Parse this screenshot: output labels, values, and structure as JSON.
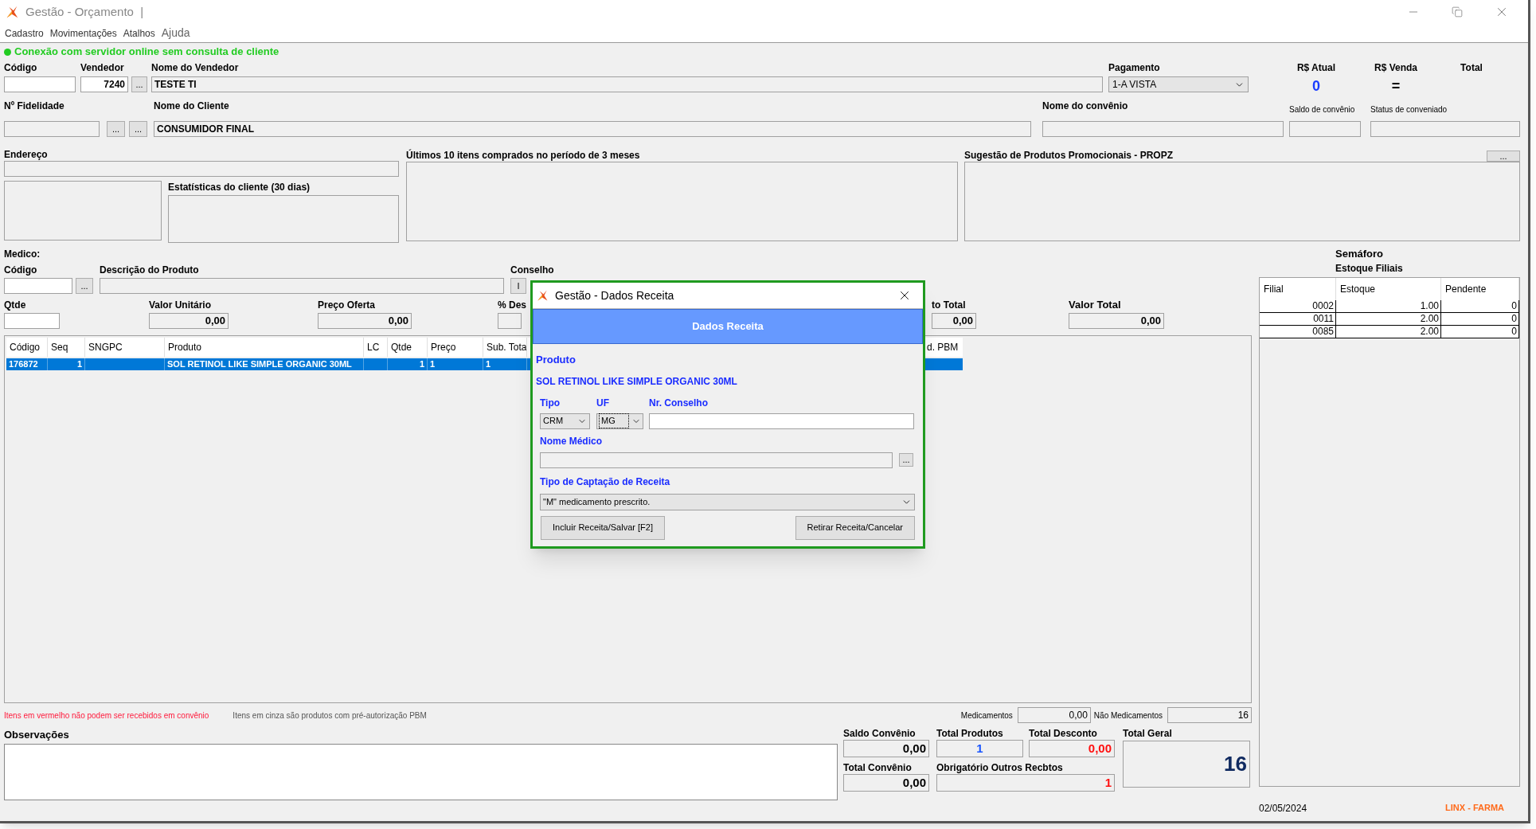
{
  "window": {
    "title": "Gestão - Orçamento  |"
  },
  "menu": [
    {
      "label": "Cadastro",
      "kind": "small"
    },
    {
      "label": "Movimentações",
      "kind": "small"
    },
    {
      "label": "Atalhos",
      "kind": "small"
    },
    {
      "label": "Ajuda",
      "kind": "large"
    }
  ],
  "connection": {
    "online": true,
    "text": "Conexão com servidor online sem consulta de cliente"
  },
  "sale": {
    "codigo_label": "Código",
    "vendedor_label": "Vendedor",
    "vendedor": "7240",
    "vendedor_button": "...",
    "nome_vendedor_label": "Nome do Vendedor",
    "nome_vendedor": "TESTE TI",
    "pagamento_label": "Pagamento",
    "pagamento": "1-A VISTA",
    "rs_atual_label": "R$ Atual",
    "rs_atual": "0",
    "rs_venda_label": "R$ Venda",
    "rs_venda": "=",
    "total_label": "Total"
  },
  "client": {
    "fidelidade_label": "Nº Fidelidade",
    "buttons": [
      "...",
      "..."
    ],
    "nome_cliente_label": "Nome do Cliente",
    "nome_cliente": "CONSUMIDOR FINAL",
    "convenio_label": "Nome do convênio",
    "saldo_label": "Saldo de convênio",
    "status_label": "Status de conveniado"
  },
  "panels": {
    "endereco_label": "Endereço",
    "estatisticas_label": "Estatísticas do cliente  (30 dias)",
    "ultimos_label": "Últimos 10 itens comprados no período de 3 meses",
    "sugestao_label": "Sugestão de Produtos Promocionais - PROPZ",
    "sugestao_button": "..."
  },
  "product_entry": {
    "medico_label": "Medico:",
    "codigo_label": "Código",
    "codigo_button": "...",
    "descricao_label": "Descrição do Produto",
    "conselho_label": "Conselho",
    "conselho_button": "I",
    "qtde_label": "Qtde",
    "valor_unitario_label": "Valor Unitário",
    "valor_unitario": "0,00",
    "preco_oferta_label": "Preço Oferta",
    "preco_oferta": "0,00",
    "desconto_label": "% Des",
    "desconto_total_label": "to Total",
    "desconto_total": "0,00",
    "valor_total_label": "Valor Total",
    "valor_total": "0,00"
  },
  "items_table": {
    "columns": [
      "Código",
      "Seq",
      "SNGPC",
      "Produto",
      "LC",
      "Qtde",
      "Preço",
      "Sub. Tota"
    ],
    "pbm_column": "d. PBM",
    "rows": [
      {
        "codigo": "176872",
        "seq": "1",
        "produto": "SOL RETINOL LIKE SIMPLE ORGANIC 30ML",
        "qtde": "1",
        "preco": "1",
        "subtotal": "1",
        "selected": true
      }
    ]
  },
  "notes": {
    "red": "Itens em vermelho não podem ser recebidos em convênio",
    "gray": "Itens em cinza são produtos com pré-autorização PBM"
  },
  "medicamentos": {
    "label": "Medicamentos",
    "value": "0,00"
  },
  "nao_medicamentos": {
    "label": "Não Medicamentos",
    "value": "16"
  },
  "observacoes_label": "Observações",
  "totals": {
    "saldo_convenio_label": "Saldo Convênio",
    "saldo_convenio": "0,00",
    "total_produtos_label": "Total Produtos",
    "total_produtos": "1",
    "total_desconto_label": "Total Desconto",
    "total_desconto": "0,00",
    "total_geral_label": "Total Geral",
    "total_geral": "16",
    "total_convenio_label": "Total Convênio",
    "total_convenio": "0,00",
    "obrigatorio_label": "Obrigatório Outros Recbtos",
    "obrigatorio": "1"
  },
  "semaforo": {
    "title": "Semáforo",
    "subtitle": "Estoque Filiais",
    "columns": [
      "Filial",
      "Estoque",
      "Pendente"
    ],
    "rows": [
      [
        "0002",
        "1.00",
        "0"
      ],
      [
        "0011",
        "2.00",
        "0"
      ],
      [
        "0085",
        "2.00",
        "0"
      ]
    ]
  },
  "footer": {
    "date": "02/05/2024",
    "brand": "LINX - FARMA"
  },
  "dialog": {
    "title": "Gestão - Dados Receita",
    "header": "Dados Receita",
    "produto_label": "Produto",
    "produto": "SOL RETINOL LIKE SIMPLE ORGANIC 30ML",
    "tipo_label": "Tipo",
    "tipo": "CRM",
    "uf_label": "UF",
    "uf": "MG",
    "conselho_label": "Nr. Conselho",
    "medico_label": "Nome Médico",
    "medico_button": "...",
    "captacao_label": "Tipo de Captação de Receita",
    "captacao": "\"M\" medicamento prescrito.",
    "buttons": [
      "Incluir Receita/Salvar [F2]",
      "Retirar Receita/Cancelar"
    ]
  }
}
